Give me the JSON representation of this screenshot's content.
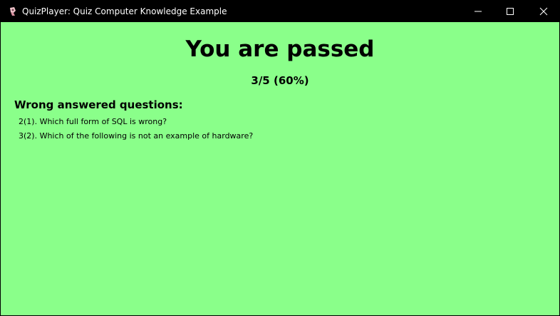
{
  "window": {
    "title": "QuizPlayer: Quiz Computer Knowledge Example",
    "app_icon": "quizplayer-app-icon",
    "controls": {
      "minimize_icon": "minimize-icon",
      "maximize_icon": "maximize-icon",
      "close_icon": "close-icon"
    }
  },
  "result": {
    "heading": "You are passed",
    "score": "3/5 (60%)",
    "background_color": "#8aff8a"
  },
  "wrong_answers": {
    "heading": "Wrong answered questions:",
    "items": [
      "2(1). Which full form of SQL is wrong?",
      "3(2). Which of the following is not an example of hardware?"
    ]
  }
}
